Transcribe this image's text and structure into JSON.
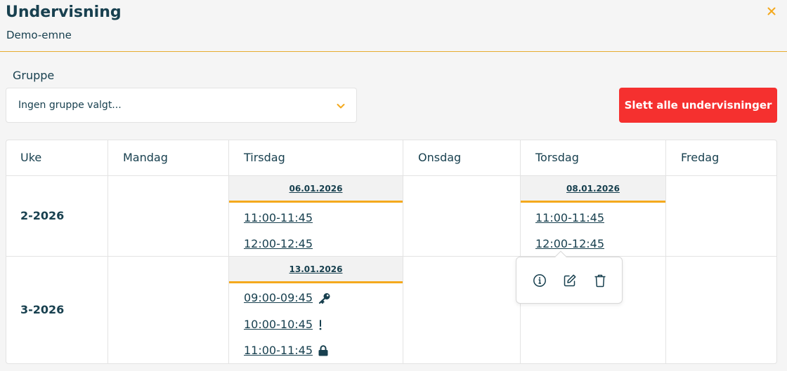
{
  "header": {
    "title": "Undervisning",
    "subtitle": "Demo-emne",
    "close_icon": "close-icon"
  },
  "group": {
    "label": "Gruppe",
    "selected": "Ingen gruppe valgt..."
  },
  "actions": {
    "delete_all_label": "Slett alle undervisninger"
  },
  "colors": {
    "accent": "#f4a91d",
    "danger": "#f5302f",
    "text": "#18404f"
  },
  "table": {
    "headers": [
      "Uke",
      "Mandag",
      "Tirsdag",
      "Onsdag",
      "Torsdag",
      "Fredag"
    ],
    "weeks": [
      {
        "week": "2-2026",
        "tuesday": {
          "date": "06.01.2026",
          "slots": [
            {
              "time": "11:00-11:45",
              "icon": ""
            },
            {
              "time": "12:00-12:45",
              "icon": ""
            }
          ]
        },
        "thursday": {
          "date": "08.01.2026",
          "slots": [
            {
              "time": "11:00-11:45",
              "icon": ""
            },
            {
              "time": "12:00-12:45",
              "icon": ""
            }
          ]
        }
      },
      {
        "week": "3-2026",
        "tuesday": {
          "date": "13.01.2026",
          "slots": [
            {
              "time": "09:00-09:45",
              "icon": "key-icon"
            },
            {
              "time": "10:00-10:45",
              "icon": "exclamation-icon"
            },
            {
              "time": "11:00-11:45",
              "icon": "lock-icon"
            }
          ]
        }
      }
    ]
  },
  "popover": {
    "actions": [
      "info-icon",
      "edit-icon",
      "delete-icon"
    ]
  }
}
